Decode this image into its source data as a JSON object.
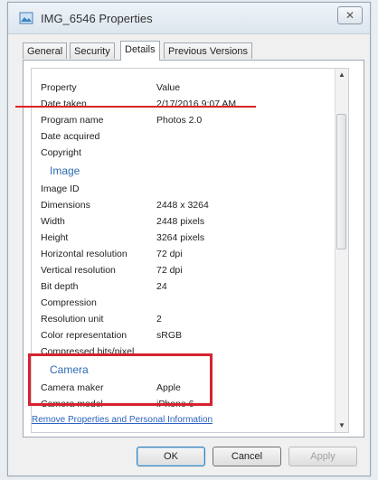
{
  "window": {
    "title": "IMG_6546 Properties",
    "close_label": "✕"
  },
  "tabs": [
    {
      "label": "General",
      "active": false
    },
    {
      "label": "Security",
      "active": false
    },
    {
      "label": "Details",
      "active": true
    },
    {
      "label": "Previous Versions",
      "active": false
    }
  ],
  "table": {
    "header": {
      "property": "Property",
      "value": "Value"
    },
    "rows": [
      {
        "property": "Date taken",
        "value": "2/17/2016 9:07 AM"
      },
      {
        "property": "Program name",
        "value": "Photos 2.0"
      },
      {
        "property": "Date acquired",
        "value": ""
      },
      {
        "property": "Copyright",
        "value": ""
      }
    ],
    "image_section": "Image",
    "image_rows": [
      {
        "property": "Image ID",
        "value": ""
      },
      {
        "property": "Dimensions",
        "value": "2448 x 3264"
      },
      {
        "property": "Width",
        "value": "2448 pixels"
      },
      {
        "property": "Height",
        "value": "3264 pixels"
      },
      {
        "property": "Horizontal resolution",
        "value": "72 dpi"
      },
      {
        "property": "Vertical resolution",
        "value": "72 dpi"
      },
      {
        "property": "Bit depth",
        "value": "24"
      },
      {
        "property": "Compression",
        "value": ""
      },
      {
        "property": "Resolution unit",
        "value": "2"
      },
      {
        "property": "Color representation",
        "value": "sRGB"
      },
      {
        "property": "Compressed bits/pixel",
        "value": ""
      }
    ],
    "camera_section": "Camera",
    "camera_rows": [
      {
        "property": "Camera maker",
        "value": "Apple"
      },
      {
        "property": "Camera model",
        "value": "iPhone 6"
      }
    ]
  },
  "link": "Remove Properties and Personal Information",
  "buttons": {
    "ok": "OK",
    "cancel": "Cancel",
    "apply": "Apply"
  },
  "colors": {
    "highlight": "#d6232f",
    "link": "#2d62c0",
    "section": "#2e6bb3"
  }
}
